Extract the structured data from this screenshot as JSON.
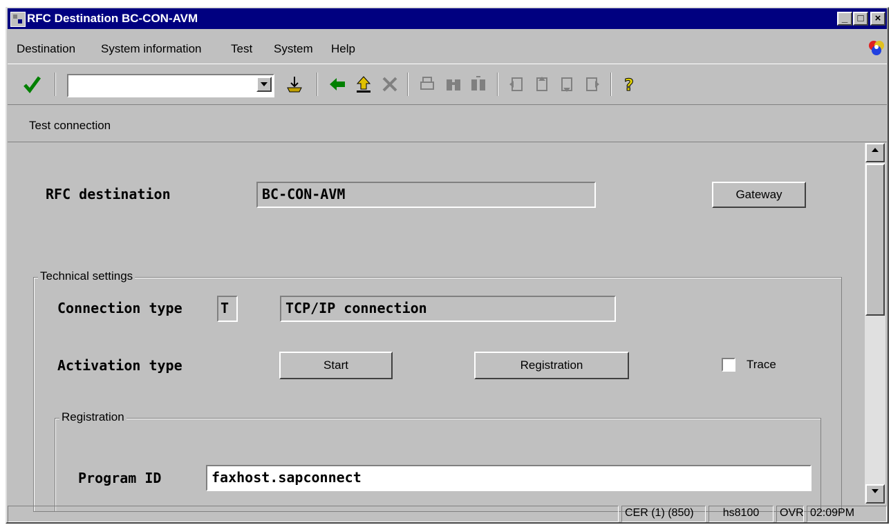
{
  "window": {
    "title": "RFC Destination BC-CON-AVM"
  },
  "menu": [
    {
      "label": "Destination"
    },
    {
      "label": "System information"
    },
    {
      "label": "Test"
    },
    {
      "label": "System"
    },
    {
      "label": "Help"
    }
  ],
  "toolbar": {
    "command_value": "",
    "icons": [
      "enter-check-icon",
      "save-icon",
      "back-icon",
      "exit-icon",
      "cancel-icon",
      "print-icon",
      "find-icon",
      "find-next-icon",
      "first-page-icon",
      "previous-page-icon",
      "next-page-icon",
      "last-page-icon",
      "help-icon"
    ]
  },
  "appbar": {
    "test_connection": "Test connection"
  },
  "rfc": {
    "label": "RFC destination",
    "value": "BC-CON-AVM",
    "gateway_button": "Gateway"
  },
  "technical": {
    "group_title": "Technical settings",
    "connection_type_label": "Connection type",
    "connection_type_code": "T",
    "connection_type_desc": "TCP/IP connection",
    "activation_type_label": "Activation type",
    "start_button": "Start",
    "registration_button": "Registration",
    "trace_label": "Trace",
    "trace_checked": false
  },
  "registration": {
    "group_title": "Registration",
    "program_id_label": "Program ID",
    "program_id_value": "faxhost.sapconnect"
  },
  "status": {
    "system": "CER (1) (850)",
    "host": "hs8100",
    "mode": "OVR",
    "time": "02:09PM"
  },
  "colors": {
    "titlebar": "#000080",
    "face": "#c0c0c0"
  }
}
